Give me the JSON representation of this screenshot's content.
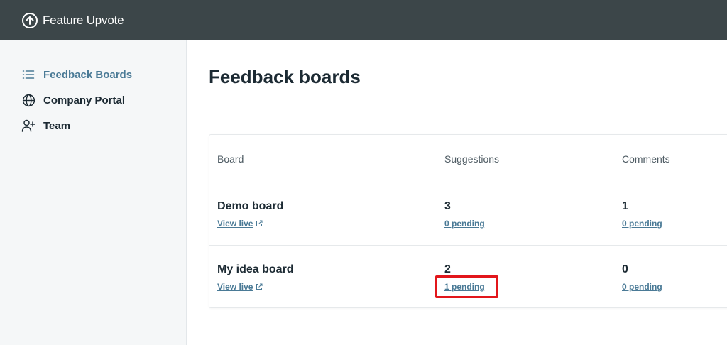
{
  "app": {
    "name": "Feature Upvote"
  },
  "sidebar": {
    "items": [
      {
        "label": "Feedback Boards",
        "icon": "list-icon",
        "active": true
      },
      {
        "label": "Company Portal",
        "icon": "globe-icon",
        "active": false
      },
      {
        "label": "Team",
        "icon": "user-plus-icon",
        "active": false
      }
    ]
  },
  "main": {
    "title": "Feedback boards",
    "table": {
      "columns": [
        "Board",
        "Suggestions",
        "Comments"
      ],
      "rows": [
        {
          "board": "Demo board",
          "view_live": "View live",
          "suggestions": "3",
          "suggestions_pending": "0 pending",
          "comments": "1",
          "comments_pending": "0 pending"
        },
        {
          "board": "My idea board",
          "view_live": "View live",
          "suggestions": "2",
          "suggestions_pending": "1 pending",
          "comments": "0",
          "comments_pending": "0 pending"
        }
      ]
    }
  },
  "colors": {
    "topbar": "#3c4649",
    "accent": "#4a7a96",
    "highlight": "#e2161b",
    "sidebar_bg": "#f5f7f8"
  }
}
